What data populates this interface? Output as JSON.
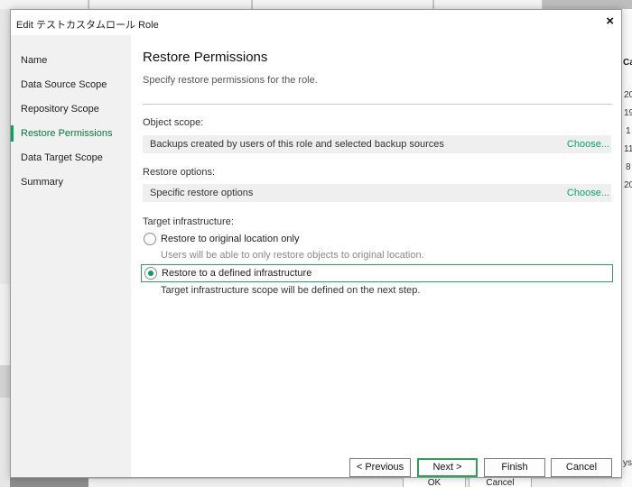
{
  "dialog": {
    "title": "Edit テストカスタムロール Role",
    "close_symbol": "×"
  },
  "steps": [
    {
      "label": "Name",
      "active": false
    },
    {
      "label": "Data Source Scope",
      "active": false
    },
    {
      "label": "Repository Scope",
      "active": false
    },
    {
      "label": "Restore Permissions",
      "active": true
    },
    {
      "label": "Data Target Scope",
      "active": false
    },
    {
      "label": "Summary",
      "active": false
    }
  ],
  "page": {
    "heading": "Restore Permissions",
    "subtitle": "Specify restore permissions for the role.",
    "object_scope": {
      "label": "Object scope:",
      "value": "Backups created by users of this role and selected backup sources",
      "link": "Choose..."
    },
    "restore_options": {
      "label": "Restore options:",
      "value": "Specific restore options",
      "link": "Choose..."
    },
    "target_infrastructure": {
      "label": "Target infrastructure:",
      "options": [
        {
          "label": "Restore to original location only",
          "hint": "Users will be able to only restore objects to original location.",
          "selected": false
        },
        {
          "label": "Restore to a defined infrastructure",
          "hint": "Target infrastructure scope will be defined on the next step.",
          "selected": true
        }
      ]
    }
  },
  "buttons": {
    "previous": "< Previous",
    "next": "Next >",
    "finish": "Finish",
    "cancel": "Cancel"
  },
  "background_window": {
    "column_header": "Ca",
    "cells": [
      "20",
      "19",
      "1",
      "11",
      "8",
      "20"
    ],
    "footer_text": "ys",
    "ok": "OK",
    "cancel": "Cancel"
  },
  "colors": {
    "accent": "#00a65a",
    "link": "#00a86b",
    "sidebar": "#f1f1f1"
  }
}
